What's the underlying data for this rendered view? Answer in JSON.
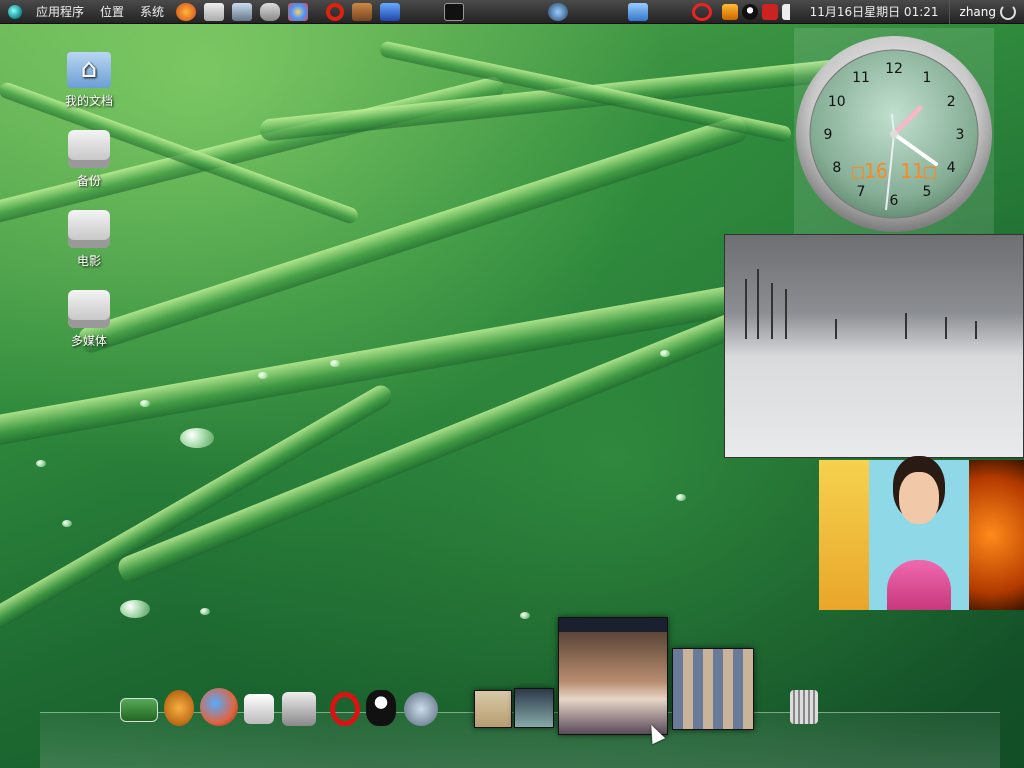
{
  "top_panel": {
    "menus": [
      "应用程序",
      "位置",
      "系统"
    ],
    "launchers": [
      "firefox-icon",
      "mail-icon",
      "photo-viewer-icon",
      "coffee-icon",
      "art-icon",
      "opera-icon",
      "app-icon",
      "window-icon",
      "terminal-icon"
    ],
    "center_icons": [
      "network-icon",
      "sync-icon",
      "power-red-icon"
    ],
    "tray": [
      "updates-icon",
      "qq-icon",
      "chinese-input-icon",
      "volume-icon"
    ],
    "clock": "11月16日星期日 01:21",
    "user": "zhang"
  },
  "desktop_icons": [
    {
      "label": "我的文档",
      "icon": "home-folder-icon"
    },
    {
      "label": "备份",
      "icon": "drive-icon"
    },
    {
      "label": "电影",
      "icon": "drive-icon"
    },
    {
      "label": "多媒体",
      "icon": "drive-icon"
    }
  ],
  "clock_widget": {
    "hours": [
      "12",
      "1",
      "2",
      "3",
      "4",
      "5",
      "6",
      "7",
      "8",
      "9",
      "10",
      "11"
    ],
    "digital": "□16 11□"
  },
  "dock": {
    "items": [
      "desktop-preview-icon",
      "rugby-icon",
      "firefox-icon",
      "photo-icon",
      "mail-icon",
      "opera-icon",
      "qq-penguin-icon",
      "media-player-icon",
      "trash-icon"
    ]
  },
  "colors": {
    "panel": "#2a2a2a",
    "accent": "#f28c28"
  }
}
